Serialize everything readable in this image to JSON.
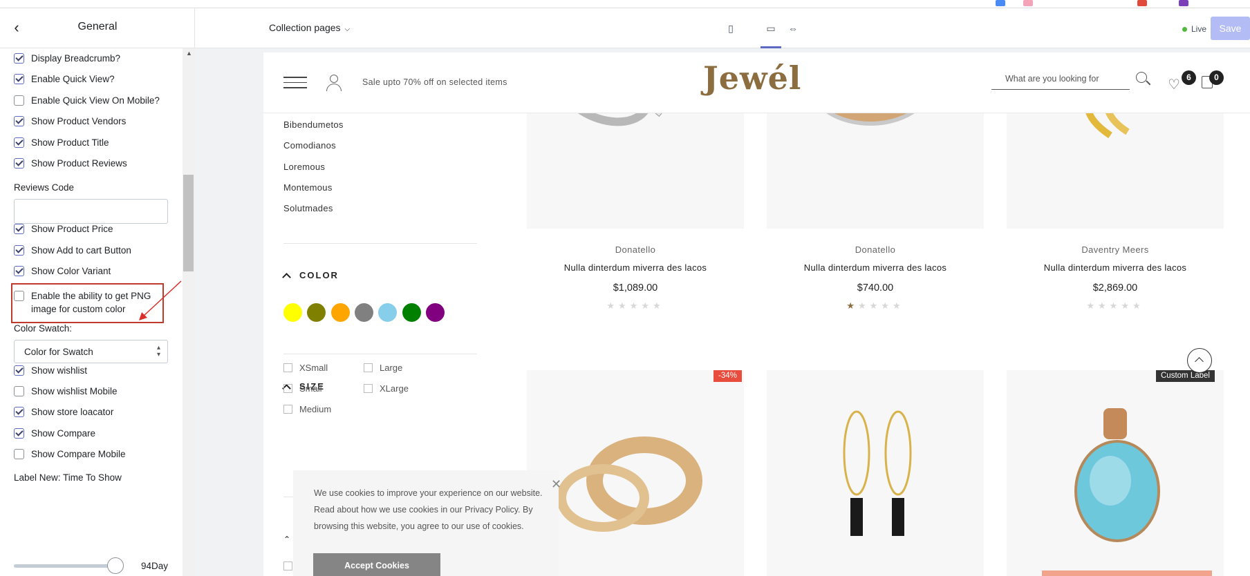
{
  "panel": {
    "title": "General",
    "options_top": [
      {
        "label": "Display Breadcrumb?",
        "checked": true
      },
      {
        "label": "Enable Quick View?",
        "checked": true
      },
      {
        "label": "Enable Quick View On Mobile?",
        "checked": false
      },
      {
        "label": "Show Product Vendors",
        "checked": true
      },
      {
        "label": "Show Product Title",
        "checked": true
      },
      {
        "label": "Show Product Reviews",
        "checked": true
      }
    ],
    "reviews_code_label": "Reviews Code",
    "reviews_code_value": "",
    "options_mid": [
      {
        "label": "Show Product Price",
        "checked": true
      },
      {
        "label": "Show Add to cart Button",
        "checked": true
      },
      {
        "label": "Show Color Variant",
        "checked": true
      }
    ],
    "png_option": {
      "label": "Enable the ability to get PNG image for custom color",
      "checked": false
    },
    "color_swatch_label": "Color Swatch:",
    "color_swatch_value": "Color for Swatch",
    "options_bottom": [
      {
        "label": "Show wishlist",
        "checked": true
      },
      {
        "label": "Show wishlist Mobile",
        "checked": false
      },
      {
        "label": "Show store loacator",
        "checked": true
      },
      {
        "label": "Show Compare",
        "checked": true
      },
      {
        "label": "Show Compare Mobile",
        "checked": false
      }
    ],
    "label_new_title": "Label New: Time To Show",
    "label_new_value": "94Day",
    "label_new_fraction": 0.94
  },
  "toolbar": {
    "page_select": "Collection pages",
    "status": "Live",
    "save_label": "Save"
  },
  "store": {
    "promo": "Sale upto 70% off on selected items",
    "logo": "Jewél",
    "search_placeholder": "What are you looking for",
    "wishlist_count": "6",
    "cart_count": "0",
    "categories": [
      "Bibendumetos",
      "Comodianos",
      "Loremous",
      "Montemous",
      "Solutmades"
    ],
    "color_heading": "COLOR",
    "colors": [
      "#ffff00",
      "#808000",
      "#ffa500",
      "#808080",
      "#87ceeb",
      "#008000",
      "#800080"
    ],
    "size_heading": "SIZE",
    "sizes": [
      "XSmall",
      "Large",
      "Small",
      "XLarge",
      "Medium"
    ],
    "products": [
      {
        "vendor": "Donatello",
        "name": "Nulla dinterdum miverra des lacos",
        "price": "$1,089.00",
        "rating": 0
      },
      {
        "vendor": "Donatello",
        "name": "Nulla dinterdum miverra des lacos",
        "price": "$740.00",
        "rating": 1
      },
      {
        "vendor": "Daventry Meers",
        "name": "Nulla dinterdum miverra des lacos",
        "price": "$2,869.00",
        "rating": 0
      }
    ],
    "sale_badge": "-34%",
    "custom_badge": "Custom Label",
    "cookie": {
      "message": "We use cookies to improve your experience on our website. Read about how we use cookies in our Privacy Policy. By browsing this website, you agree to our use of cookies.",
      "accept": "Accept Cookies"
    }
  },
  "colors": {
    "accent": "#5c6ac4",
    "brand": "#8b6d3f",
    "highlight": "#c0392b",
    "live": "#50b83c"
  }
}
